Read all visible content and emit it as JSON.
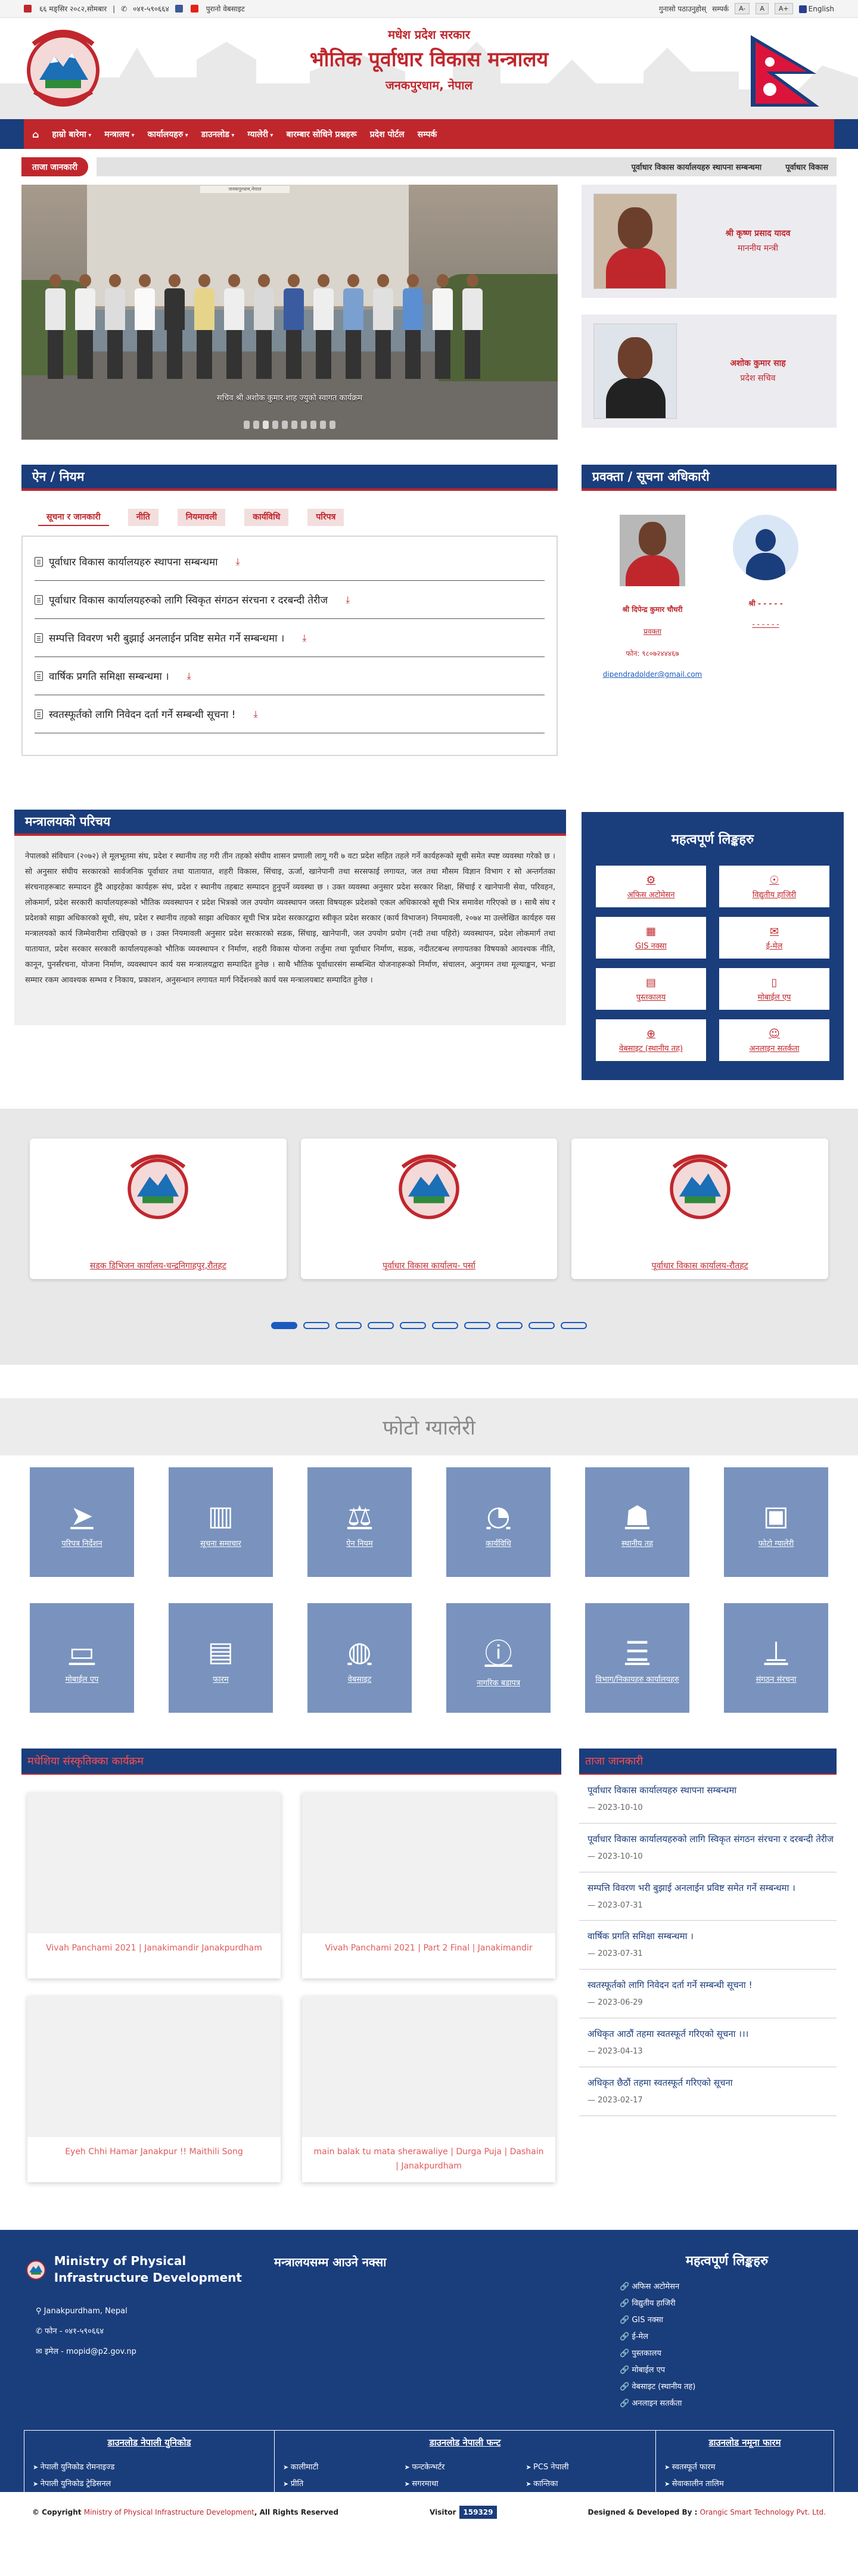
{
  "topbar": {
    "date": "६६ मङ्सिर २०८२,सोमबार",
    "phone": "०४१-५९०६६४",
    "old_website": "पुरानो वेबसाइट",
    "grievance": "गुनासो पठाउनुहोस्",
    "contact": "सम्पर्क",
    "font_minus": "A-",
    "font_normal": "A",
    "font_plus": "A+",
    "language": "English"
  },
  "header": {
    "line1": "मधेश प्रदेश सरकार",
    "line2": "भौतिक पूर्वाधार विकास मन्त्रालय",
    "line3": "जनकपुरधाम, नेपाल"
  },
  "nav": [
    "हाम्रो बारेमा",
    "मन्त्रालय",
    "कार्यालयहरु",
    "डाउनलोड",
    "ग्यालेरी",
    "बारम्बार सोधिने प्रश्नहरू",
    "प्रदेश पोर्टल",
    "सम्पर्क"
  ],
  "ticker": {
    "label": "ताजा जानकारी",
    "items": [
      "पूर्वाधार विकास कार्यालयहरु स्थापना सम्बन्धमा",
      "पूर्वाधार विकास"
    ]
  },
  "slider": {
    "sign": "जनकपुरधाम,नेपाल",
    "caption": "सचिव श्री अशोक कुमार शाह ज्युको स्वागत कार्यक्रम"
  },
  "officials": [
    {
      "name": "श्री कृष्ण प्रसाद यादव",
      "role": "माननीय मन्त्री"
    },
    {
      "name": "अशोक कुमार साह",
      "role": "प्रदेश सचिव"
    }
  ],
  "laws": {
    "title": "ऐन / नियम",
    "tabs": [
      "सूचना र जानकारी",
      "नीति",
      "नियमावली",
      "कार्यविधि",
      "परिपत्र"
    ],
    "items": [
      "पूर्वाधार विकास कार्यालयहरु स्थापना सम्बन्धमा",
      "पूर्वाधार विकास कार्यालयहरुको लागि स्विकृत संगठन संरचना र दरबन्दी तेरीज",
      "सम्पत्ति विवरण भरी बुझाई अनलाईन प्रविष्ट समेत गर्ने सम्बन्धमा ।",
      "वार्षिक प्रगति समिक्षा सम्बन्धमा ।",
      "स्वतस्फूर्तको लागि निवेदन दर्ता गर्ने सम्बन्धी सूचना !"
    ]
  },
  "info_officer": {
    "title": "प्रवक्ता / सूचना अधिकारी",
    "contacts": [
      {
        "name": "श्री दिपेन्द्र कुमार चौधरी",
        "designation": "प्रवक्ता",
        "phone": "फोन: ९८०७२४४४६७",
        "email": "dipendradolder@gmail.com"
      },
      {
        "name": "श्री - - - - -",
        "designation": "- - - - - -",
        "phone": "",
        "email": ""
      }
    ]
  },
  "intro": {
    "title": "मन्त्रालयको परिचय",
    "text": "नेपालको संविधान (२०७२) ले मूलभूतमा संघ, प्रदेश र स्थानीय तह गरी तीन तहको संघीय शासन प्रणाली लागू गरी ७ वटा प्रदेश सहित तहले गर्ने कार्यहरूको सूची समेत स्पष्ट व्यवस्था गरेको छ । सो अनुसार संघीय सरकारको सार्वजनिक पूर्वाधार तथा यातायात, शहरी विकास, सिंचाइ, ऊर्जा, खानेपानी तथा सरसफाई लगायत, जल तथा मौसम विज्ञान विभाग र सो अन्तर्गतका संरचनाहरूबाट सम्पादन हुँदै आइरहेका कार्यहरू संघ, प्रदेश र स्थानीय तहबाट सम्पादन हुनुपर्ने व्यवस्था छ । उक्त व्यवस्था अनुसार प्रदेश सरकार शिक्षा, सिंचाई र खानेपानी सेवा, परिवहन, लोकमार्ग, प्रदेश सरकारी कार्यालयहरूको भौतिक व्यवस्थापन र प्रदेश भित्रको जल उपयोग व्यवस्थापन जस्ता विषयहरू प्रदेशको एकल अधिकारको सूची भित्र समावेश गरिएको छ । साथै संघ र प्रदेशको साझा अधिकारको सूची, संघ, प्रदेश र स्थानीय तहको साझा अधिकार सूची भित्र प्रदेश सरकारद्वारा स्वीकृत प्रदेश सरकार (कार्य विभाजन) नियमावली, २०७४ मा उल्लेखित कार्यहरु यस मन्त्रालयको कार्य जिम्मेवारीमा राखिएको छ । उक्त नियमावली अनुसार प्रदेश सरकारको सडक, सिंचाइ, खानेपानी, जल उपयोग प्रयोग (नदी तथा पहिरो) व्यवस्थापन, प्रदेश लोकमार्ग तथा यातायात, प्रदेश सरकार सरकारी कार्यालयहरूको भौतिक व्यवस्थापन र निर्माण, शहरी विकास योजना तर्जुमा तथा पूर्वाधार निर्माण, सडक, नदीतटबन्ध लगायतका विषयको आवश्यक नीति, कानून, पुनर्संरचना, योजना निर्माण, व्यवस्थापन कार्य यस मन्त्रालयद्वारा सम्पादित हुनेछ । साथै भौतिक पूर्वाधारसंग सम्बन्धित योजनाहरूको निर्माण, संचालन, अनुगमन तथा मूल्याङ्कन, भन्डा सम्मार रकम आवश्यक सम्भव र निकाय, प्रकाशन, अनुसन्धान लगायत मार्ग निर्देशनको कार्य यस मन्त्रालयबाट सम्पादित हुनेछ ।"
  },
  "important_links": {
    "title": "महत्वपूर्ण लिङ्कहरु",
    "items": [
      {
        "label": "अफिस अटोमेसन",
        "icon": "gear-icon"
      },
      {
        "label": "विद्युतीय हाजिरी",
        "icon": "fingerprint-icon"
      },
      {
        "label": "GIS नक्सा",
        "icon": "map-icon"
      },
      {
        "label": "ई-मेल",
        "icon": "mail-icon"
      },
      {
        "label": "पुस्तकालय",
        "icon": "book-icon"
      },
      {
        "label": "मोबाईल एप",
        "icon": "mobile-icon"
      },
      {
        "label": "वेबसाइट (स्थानीय तह)",
        "icon": "globe-icon"
      },
      {
        "label": "अनलाइन सतर्कता",
        "icon": "users-icon"
      }
    ]
  },
  "offices": [
    "सडक डिभिजन कार्यालय-चन्द्रनिगाहपुर,रौतहट",
    "पूर्वाधार विकास कार्यालय- पर्सा",
    "पूर्वाधार विकास कार्यालय-रौतहट"
  ],
  "gallery": {
    "title": "फोटो ग्यालेरी",
    "tiles": [
      {
        "label": "परिपत्र निर्देशन",
        "icon": "send-icon"
      },
      {
        "label": "सूचना समाचार",
        "icon": "book-open-icon"
      },
      {
        "label": "ऐन नियम",
        "icon": "scales-icon"
      },
      {
        "label": "कार्यविधि",
        "icon": "rss-icon"
      },
      {
        "label": "स्थानीय तह",
        "icon": "reader-icon"
      },
      {
        "label": "फोटो ग्यालेरी",
        "icon": "gallery-icon"
      },
      {
        "label": "मोबाईल एप",
        "icon": "tablet-icon"
      },
      {
        "label": "फारम",
        "icon": "book-icon"
      },
      {
        "label": "वेबसाइट",
        "icon": "globe-icon"
      },
      {
        "label": "नागरिक बडापत्र",
        "icon": "alert-icon"
      },
      {
        "label": "विभाग/निकायहरु कार्यालयहरु",
        "icon": "list-icon"
      },
      {
        "label": "संगठन संरचना",
        "icon": "org-chart-icon"
      }
    ]
  },
  "videos": {
    "title": "मधेशिया संस्कृतिक्का कार्यक्रम",
    "items": [
      "Vivah Panchami 2021 | Janakimandir Janakpurdham",
      "Vivah Panchami 2021 | Part 2 Final | Janakimandir",
      "Eyeh Chhi Hamar Janakpur !! Maithili Song",
      "main balak tu mata sherawaliye | Durga Puja | Dashain | Janakpurdham"
    ]
  },
  "latest_news": {
    "title": "ताजा जानकारी",
    "items": [
      {
        "title": "पूर्वाधार विकास कार्यालयहरु स्थापना सम्बन्धमा",
        "date": "2023-10-10"
      },
      {
        "title": "पूर्वाधार विकास कार्यालयहरुको लागि स्विकृत संगठन संरचना र दरबन्दी तेरीज",
        "date": "2023-10-10"
      },
      {
        "title": "सम्पत्ति विवरण भरी बुझाई अनलाईन प्रविष्ट समेत गर्ने सम्बन्धमा ।",
        "date": "2023-07-31"
      },
      {
        "title": "वार्षिक प्रगति समिक्षा सम्बन्धमा ।",
        "date": "2023-07-31"
      },
      {
        "title": "स्वतस्फूर्तको लागि निवेदन दर्ता गर्ने सम्बन्धी सूचना !",
        "date": "2023-06-29"
      },
      {
        "title": "अधिकृत आठौं तहमा स्वतस्फूर्त गरिएको सूचना ।।।",
        "date": "2023-04-13"
      },
      {
        "title": "अधिकृत छैठौं तहमा स्वतस्फूर्त गरिएको सूचना",
        "date": "2023-02-17"
      }
    ]
  },
  "footer": {
    "org_name": "Ministry of Physical Infrastructure Development",
    "address": "Janakpurdham, Nepal",
    "phone": "फोन - ०४१-५९०६६४",
    "email": "इमेल - mopid@p2.gov.np",
    "map_title": "मन्त्रालयसम्म आउने नक्सा",
    "links_title": "महत्वपूर्ण लिङ्कहरु",
    "links": [
      "अफिस अटोमेसन",
      "विद्युतीय हाजिरी",
      "GIS नक्सा",
      "ई-मेल",
      "पुस्तकालय",
      "मोबाईल एप",
      "वेबसाइट (स्थानीय तह)",
      "अनलाइन सतर्कता"
    ],
    "download_unicode_title": "डाउनलोड नेपाली युनिकोड",
    "download_unicode": [
      "नेपाली युनिकोड रोमनाइज्ड",
      "नेपाली युनिकोड ट्रेडिसनल"
    ],
    "download_font_title": "डाउनलोड नेपाली फन्ट",
    "download_fonts": [
      "कालीमाटी",
      "प्रीति",
      "फन्टकेन्भर्टर",
      "सगरमाथा",
      "PCS नेपाली",
      "कान्तिका"
    ],
    "download_forms_title": "डाउनलोड नमूना फारम",
    "download_forms": [
      "स्वतस्फूर्त फारम",
      "सेवाकालीन तालिम"
    ],
    "copyright_prefix": "© Copyright",
    "copyright_org": "Ministry of Physical Infrastructure Development",
    "copyright_suffix": ", All Rights Reserved",
    "visitor_label": "Visitor",
    "visitor_count": "159329",
    "designed_by": "Designed & Developed By :",
    "developer": "Orangic Smart Technology Pvt. Ltd."
  }
}
